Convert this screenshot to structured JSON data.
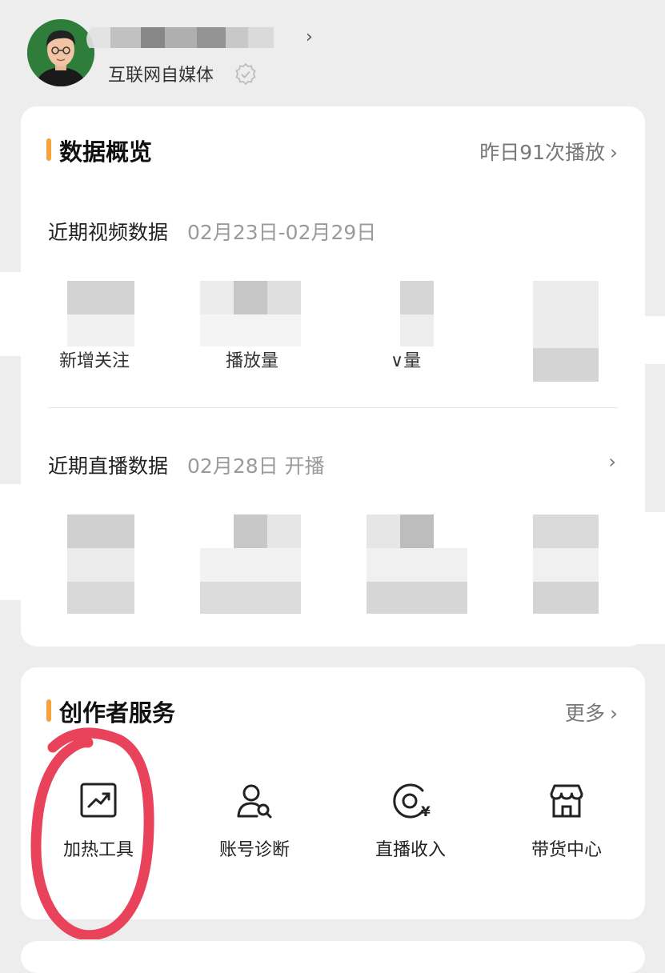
{
  "header": {
    "subtitle": "互联网自媒体",
    "name_chevron": "›"
  },
  "overview": {
    "title": "数据概览",
    "plays_link": "昨日91次播放",
    "chevron": "›",
    "video": {
      "label": "近期视频数据",
      "date_range": "02月23日-02月29日",
      "stats": [
        "新增关注",
        "播放量",
        "∨量"
      ]
    },
    "live": {
      "label": "近期直播数据",
      "date": "02月28日 开播",
      "chevron": "›"
    }
  },
  "services": {
    "title": "创作者服务",
    "more": "更多",
    "chevron": "›",
    "items": [
      {
        "label": "加热工具",
        "icon": "trending-up-icon"
      },
      {
        "label": "账号诊断",
        "icon": "user-search-icon"
      },
      {
        "label": "直播收入",
        "icon": "live-income-icon"
      },
      {
        "label": "带货中心",
        "icon": "store-icon"
      }
    ]
  },
  "colors": {
    "accent_bar": "#f5a33a",
    "annotation": "#e8435a",
    "avatar_bg": "#2f7d3a"
  }
}
